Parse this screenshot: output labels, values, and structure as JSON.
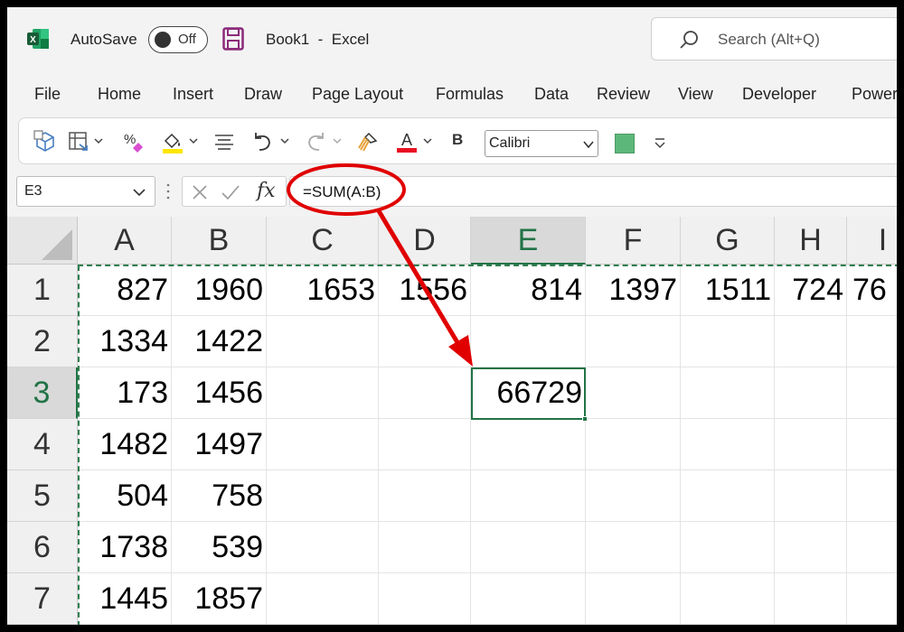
{
  "titlebar": {
    "autosave_label": "AutoSave",
    "autosave_state": "Off",
    "document_title": "Book1  -  Excel",
    "search_placeholder": "Search (Alt+Q)"
  },
  "menu": {
    "tabs": [
      "File",
      "Home",
      "Insert",
      "Draw",
      "Page Layout",
      "Formulas",
      "Data",
      "Review",
      "View",
      "Developer",
      "Power"
    ]
  },
  "ribbon": {
    "font_name": "Calibri",
    "bold_label": "B",
    "fill_color": "#5cb87a",
    "font_color_bar": "#e81123",
    "highlight_color_bar": "#ffe600",
    "icons": [
      "3d-models-icon",
      "pivot-table-icon",
      "percent-style-icon",
      "fill-color-icon",
      "align-icon",
      "undo-icon",
      "redo-icon",
      "format-painter-icon",
      "font-color-icon",
      "customize-icon"
    ]
  },
  "formula_bar": {
    "name_box": "E3",
    "fx_label": "fx",
    "formula": "=SUM(A:B)"
  },
  "grid": {
    "columns": [
      "A",
      "B",
      "C",
      "D",
      "E",
      "F",
      "G",
      "H",
      "I"
    ],
    "rows": [
      "1",
      "2",
      "3",
      "4",
      "5",
      "6",
      "7"
    ],
    "active_column": "E",
    "active_row": "3",
    "cells": [
      {
        "ref": "A1",
        "value": "827"
      },
      {
        "ref": "B1",
        "value": "1960"
      },
      {
        "ref": "C1",
        "value": "1653"
      },
      {
        "ref": "D1",
        "value": "1556"
      },
      {
        "ref": "E1",
        "value": "814"
      },
      {
        "ref": "F1",
        "value": "1397"
      },
      {
        "ref": "G1",
        "value": "1511"
      },
      {
        "ref": "H1",
        "value": "724"
      },
      {
        "ref": "I1",
        "value": "76"
      },
      {
        "ref": "A2",
        "value": "1334"
      },
      {
        "ref": "B2",
        "value": "1422"
      },
      {
        "ref": "A3",
        "value": "173"
      },
      {
        "ref": "B3",
        "value": "1456"
      },
      {
        "ref": "E3",
        "value": "66729"
      },
      {
        "ref": "A4",
        "value": "1482"
      },
      {
        "ref": "B4",
        "value": "1497"
      },
      {
        "ref": "A5",
        "value": "504"
      },
      {
        "ref": "B5",
        "value": "758"
      },
      {
        "ref": "A6",
        "value": "1738"
      },
      {
        "ref": "B6",
        "value": "539"
      },
      {
        "ref": "A7",
        "value": "1445"
      },
      {
        "ref": "B7",
        "value": "1857"
      }
    ]
  },
  "annotation_color": "#e00000"
}
